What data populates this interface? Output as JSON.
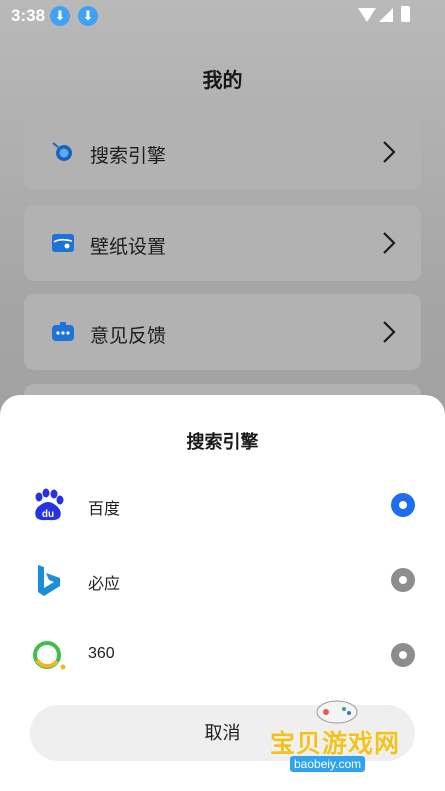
{
  "status_bar": {
    "time": "3:38"
  },
  "page": {
    "title": "我的"
  },
  "menu": [
    {
      "label": "搜索引擎",
      "icon": "search-engine-icon"
    },
    {
      "label": "壁纸设置",
      "icon": "wallpaper-icon"
    },
    {
      "label": "意见反馈",
      "icon": "feedback-icon"
    }
  ],
  "sheet": {
    "title": "搜索引擎",
    "options": [
      {
        "name": "百度",
        "icon": "baidu-logo",
        "selected": true
      },
      {
        "name": "必应",
        "icon": "bing-logo",
        "selected": false
      },
      {
        "name": "360",
        "icon": "360-logo",
        "selected": false
      }
    ],
    "cancel_label": "取消"
  },
  "watermark": {
    "text": "宝贝游戏网",
    "url": "baobeiy.com"
  },
  "colors": {
    "accent": "#1f6ef0",
    "radio_off": "#8d8d8d",
    "sheet_bg": "#ffffff"
  }
}
